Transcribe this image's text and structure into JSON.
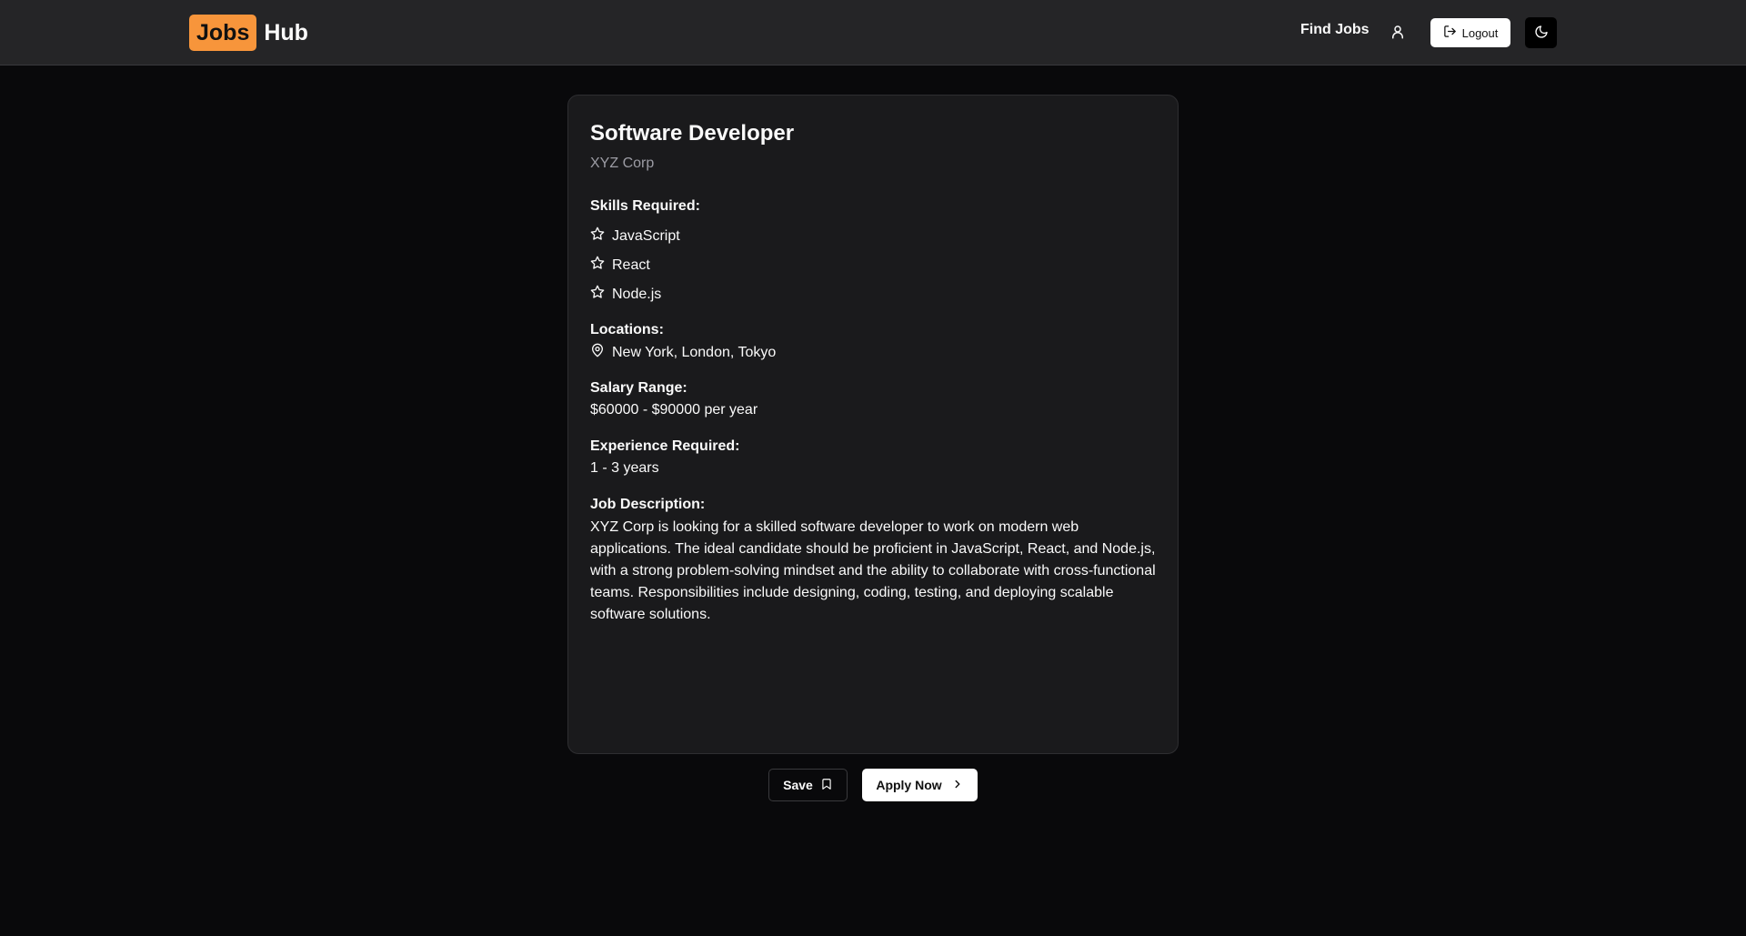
{
  "header": {
    "logo_badge": "Jobs",
    "logo_text": "Hub",
    "nav_find_jobs": "Find Jobs",
    "logout_label": "Logout"
  },
  "job": {
    "title": "Software Developer",
    "company": "XYZ Corp",
    "skills_label": "Skills Required:",
    "skills": [
      "JavaScript",
      "React",
      "Node.js"
    ],
    "locations_label": "Locations:",
    "locations": "New York, London, Tokyo",
    "salary_label": "Salary Range:",
    "salary": "$60000 - $90000 per year",
    "experience_label": "Experience Required:",
    "experience": "1 - 3 years",
    "description_label": "Job Description:",
    "description": "XYZ Corp is looking for a skilled software developer to work on modern web applications. The ideal candidate should be proficient in JavaScript, React, and Node.js, with a strong problem-solving mindset and the ability to collaborate with cross-functional teams. Responsibilities include designing, coding, testing, and deploying scalable software solutions."
  },
  "actions": {
    "save_label": "Save",
    "apply_label": "Apply Now"
  },
  "icons": {
    "user": "user-icon",
    "logout": "logout-icon",
    "theme": "moon-icon",
    "skill": "star-icon",
    "location": "map-pin-icon",
    "save": "bookmark-icon",
    "apply": "chevron-right-icon"
  },
  "colors": {
    "brand": "#f7953b",
    "background": "#09090b",
    "header": "#252527",
    "card": "#1a1a1c"
  }
}
